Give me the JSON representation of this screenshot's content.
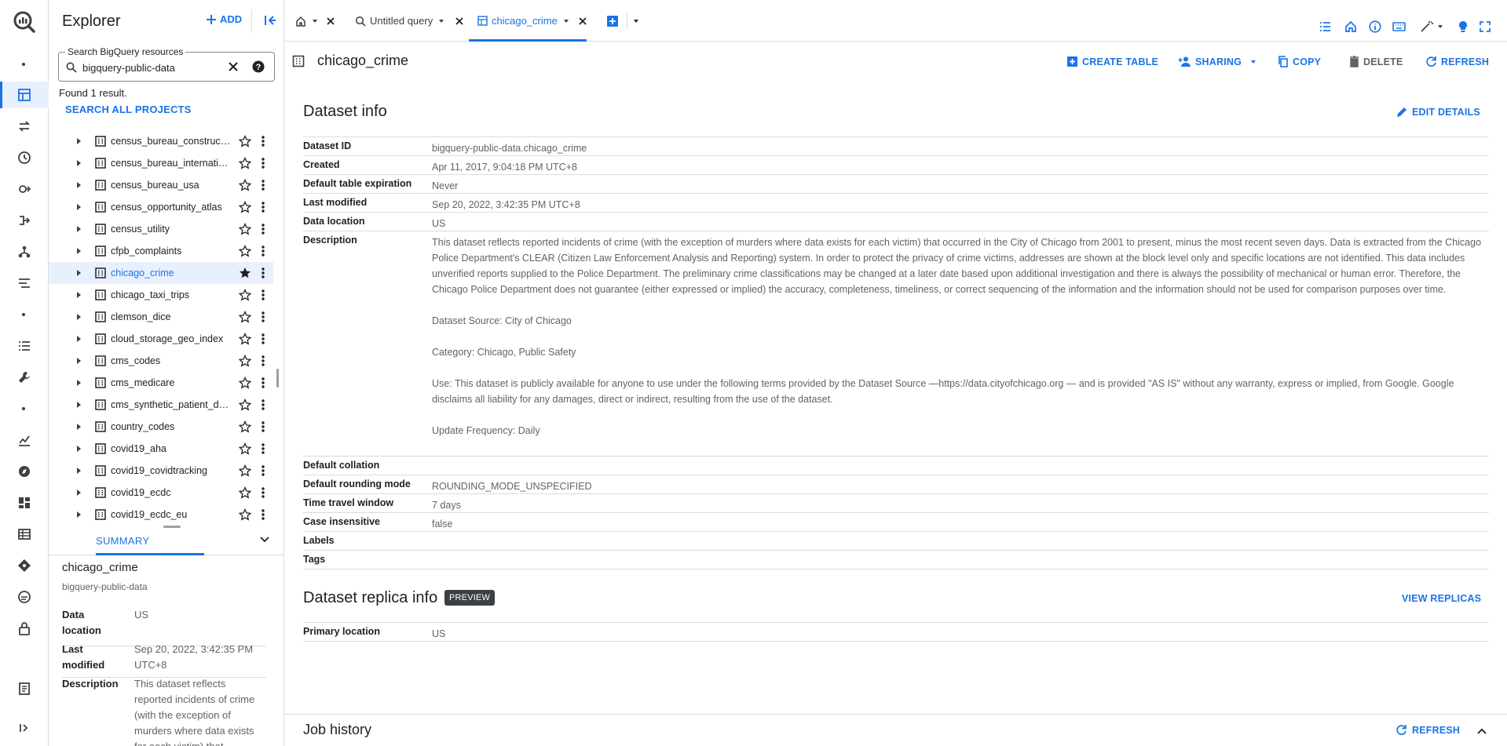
{
  "explorer": {
    "title": "Explorer",
    "add_label": "ADD",
    "search_legend": "Search BigQuery resources",
    "search_value": "bigquery-public-data",
    "found_text": "Found 1 result.",
    "search_all_label": "SEARCH ALL PROJECTS",
    "datasets": [
      "census_bureau_construction",
      "census_bureau_international",
      "census_bureau_usa",
      "census_opportunity_atlas",
      "census_utility",
      "cfpb_complaints",
      "chicago_crime",
      "chicago_taxi_trips",
      "clemson_dice",
      "cloud_storage_geo_index",
      "cms_codes",
      "cms_medicare",
      "cms_synthetic_patient_data...",
      "country_codes",
      "covid19_aha",
      "covid19_covidtracking",
      "covid19_ecdc",
      "covid19_ecdc_eu"
    ],
    "selected_dataset": "chicago_crime"
  },
  "summary": {
    "tab_label": "SUMMARY",
    "name": "chicago_crime",
    "project": "bigquery-public-data",
    "rows": [
      {
        "key": "Data location",
        "value": "US"
      },
      {
        "key": "Last modified",
        "value": "Sep 20, 2022, 3:42:35 PM UTC+8"
      },
      {
        "key": "Description",
        "value": "This dataset reflects reported incidents of crime (with the exception of murders where data exists for each victim) that"
      }
    ]
  },
  "tabs": [
    {
      "label": ""
    },
    {
      "label": "Untitled query"
    },
    {
      "label": "chicago_crime"
    }
  ],
  "dataset": {
    "title": "chicago_crime",
    "actions": {
      "create_table": "CREATE TABLE",
      "sharing": "SHARING",
      "copy": "COPY",
      "delete": "DELETE",
      "refresh": "REFRESH"
    },
    "info_title": "Dataset info",
    "edit_details": "EDIT DETAILS",
    "info": {
      "dataset_id": {
        "key": "Dataset ID",
        "value": "bigquery-public-data.chicago_crime"
      },
      "created": {
        "key": "Created",
        "value": "Apr 11, 2017, 9:04:18 PM UTC+8"
      },
      "expiration": {
        "key": "Default table expiration",
        "value": "Never"
      },
      "modified": {
        "key": "Last modified",
        "value": "Sep 20, 2022, 3:42:35 PM UTC+8"
      },
      "location": {
        "key": "Data location",
        "value": "US"
      },
      "description": {
        "key": "Description",
        "paragraphs": [
          "This dataset reflects reported incidents of crime (with the exception of murders where data exists for each victim) that occurred in the City of Chicago from 2001 to present, minus the most recent seven days. Data is extracted from the Chicago Police Department's CLEAR (Citizen Law Enforcement Analysis and Reporting) system. In order to protect the privacy of crime victims, addresses are shown at the block level only and specific locations are not identified. This data includes unverified reports supplied to the Police Department. The preliminary crime classifications may be changed at a later date based upon additional investigation and there is always the possibility of mechanical or human error. Therefore, the Chicago Police Department does not guarantee (either expressed or implied) the accuracy, completeness, timeliness, or correct sequencing of the information and the information should not be used for comparison purposes over time.",
          "Dataset Source: City of Chicago",
          "Category: Chicago, Public Safety",
          "Use: This dataset is publicly available for anyone to use under the following terms provided by the Dataset Source —https://data.cityofchicago.org — and is provided \"AS IS\" without any warranty, express or implied, from Google. Google disclaims all liability for any damages, direct or indirect, resulting from the use of the dataset.",
          "Update Frequency: Daily"
        ]
      },
      "collation": {
        "key": "Default collation",
        "value": ""
      },
      "rounding": {
        "key": "Default rounding mode",
        "value": "ROUNDING_MODE_UNSPECIFIED"
      },
      "time_travel": {
        "key": "Time travel window",
        "value": "7 days"
      },
      "case_insensitive": {
        "key": "Case insensitive",
        "value": "false"
      },
      "labels": {
        "key": "Labels",
        "value": ""
      },
      "tags": {
        "key": "Tags",
        "value": ""
      }
    },
    "replica_title": "Dataset replica info",
    "preview_badge": "PREVIEW",
    "view_replicas": "VIEW REPLICAS",
    "primary_location": {
      "key": "Primary location",
      "value": "US"
    }
  },
  "job_history": {
    "title": "Job history",
    "refresh": "REFRESH"
  },
  "colors": {
    "accent": "#1a73e8",
    "selected_bg": "#e8f0fe",
    "divider": "#dadce0",
    "muted_text": "#5f6368"
  }
}
